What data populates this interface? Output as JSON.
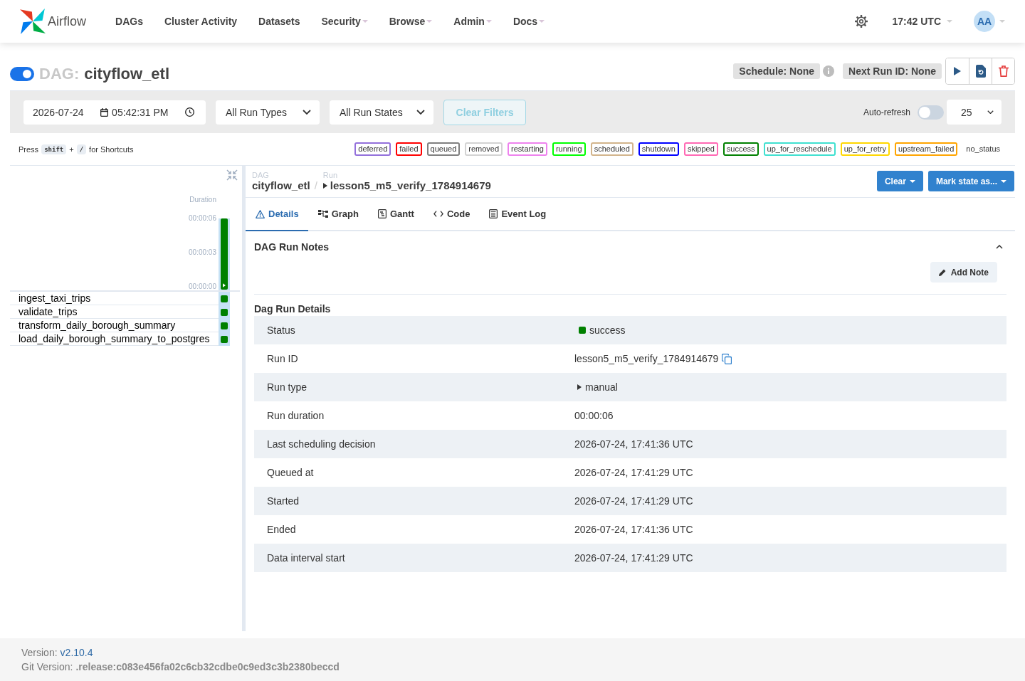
{
  "navbar": {
    "brand": "Airflow",
    "menu": [
      {
        "label": "DAGs",
        "kind": "link"
      },
      {
        "label": "Cluster Activity",
        "kind": "link"
      },
      {
        "label": "Datasets",
        "kind": "link"
      },
      {
        "label": "Security",
        "kind": "dropdown"
      },
      {
        "label": "Browse",
        "kind": "dropdown"
      },
      {
        "label": "Admin",
        "kind": "dropdown"
      },
      {
        "label": "Docs",
        "kind": "dropdown"
      }
    ],
    "clock": "17:42 UTC",
    "user_initials": "AA"
  },
  "dag_header": {
    "on": true,
    "prefix": "DAG:",
    "dag_id": "cityflow_etl",
    "schedule": "Schedule: None",
    "next_run": "Next Run ID: None"
  },
  "filters": {
    "date": "2026-07-24",
    "time": "05:42:31 PM",
    "run_type": "All Run Types",
    "run_state": "All Run States",
    "clear_button": {
      "label": "Clear Filters",
      "disabled": true
    },
    "auto_refresh": {
      "label": "Auto-refresh",
      "on": false
    },
    "page_size": "25"
  },
  "shortcut_hint": {
    "prefix": "Press",
    "keys": [
      "shift",
      "/"
    ],
    "joiner": "+",
    "suffix": "for Shortcuts"
  },
  "legend": [
    {
      "label": "deferred",
      "color": "#9370db"
    },
    {
      "label": "failed",
      "color": "#ff0000"
    },
    {
      "label": "queued",
      "color": "#808080"
    },
    {
      "label": "removed",
      "color": "#d3d3d3"
    },
    {
      "label": "restarting",
      "color": "#ee82ee"
    },
    {
      "label": "running",
      "color": "#00ff00"
    },
    {
      "label": "scheduled",
      "color": "#d2b48c"
    },
    {
      "label": "shutdown",
      "color": "#0000ff"
    },
    {
      "label": "skipped",
      "color": "#ff69b4"
    },
    {
      "label": "success",
      "color": "#008000"
    },
    {
      "label": "up_for_reschedule",
      "color": "#40e0d0"
    },
    {
      "label": "up_for_retry",
      "color": "#ffd700"
    },
    {
      "label": "upstream_failed",
      "color": "#ffa500"
    },
    {
      "label": "no_status",
      "color": "#ffffff"
    }
  ],
  "grid": {
    "run_selected": true,
    "chart_data": {
      "type": "bar",
      "ylim": [
        0,
        6
      ],
      "yticks": [
        {
          "value": 6,
          "label": "00:00:06"
        },
        {
          "value": 3,
          "label": "00:00:03"
        },
        {
          "value": 0,
          "label": "00:00:00"
        }
      ],
      "series": [
        {
          "name": "Duration",
          "color": "#008000",
          "values": [
            6
          ]
        }
      ]
    },
    "tasks": [
      {
        "name": "ingest_taxi_trips",
        "color": "#008000"
      },
      {
        "name": "validate_trips",
        "color": "#008000"
      },
      {
        "name": "transform_daily_borough_summary",
        "color": "#008000"
      },
      {
        "name": "load_daily_borough_summary_to_postgres",
        "color": "#008000"
      }
    ]
  },
  "run_panel": {
    "breadcrumb": {
      "dag_label": "DAG",
      "dag_id": "cityflow_etl",
      "separator": "/",
      "run_label": "Run",
      "run_id": "lesson5_m5_verify_1784914679"
    },
    "actions": [
      "Clear",
      "Mark state as..."
    ],
    "tabs": [
      {
        "label": "Details",
        "kind": "details",
        "selected": true
      },
      {
        "label": "Graph",
        "kind": "graph",
        "selected": false
      },
      {
        "label": "Gantt",
        "kind": "gantt",
        "selected": false
      },
      {
        "label": "Code",
        "kind": "code",
        "selected": false
      },
      {
        "label": "Event Log",
        "kind": "log",
        "selected": false
      }
    ],
    "notes": {
      "title": "DAG Run Notes",
      "expanded": true,
      "add_button": "Add Note"
    },
    "details": {
      "title": "Dag Run Details",
      "rows": [
        {
          "label": "Status",
          "value": "success",
          "kind": "status",
          "color": "#008000"
        },
        {
          "label": "Run ID",
          "value": "lesson5_m5_verify_1784914679",
          "kind": "copy"
        },
        {
          "label": "Run type",
          "value": "manual",
          "kind": "run_type"
        },
        {
          "label": "Run duration",
          "value": "00:00:06",
          "kind": "text"
        },
        {
          "label": "Last scheduling decision",
          "value": "2026-07-24, 17:41:36 UTC",
          "kind": "text"
        },
        {
          "label": "Queued at",
          "value": "2026-07-24, 17:41:29 UTC",
          "kind": "text"
        },
        {
          "label": "Started",
          "value": "2026-07-24, 17:41:29 UTC",
          "kind": "text"
        },
        {
          "label": "Ended",
          "value": "2026-07-24, 17:41:36 UTC",
          "kind": "text"
        },
        {
          "label": "Data interval start",
          "value": "2026-07-24, 17:41:29 UTC",
          "kind": "text"
        }
      ]
    }
  },
  "footer": {
    "version_label": "Version:",
    "version": "v2.10.4",
    "git_label": "Git Version:",
    "git_version": ".release:c083e456fa02c6cb32cdbe0c9ed3c3b2380beccd"
  }
}
